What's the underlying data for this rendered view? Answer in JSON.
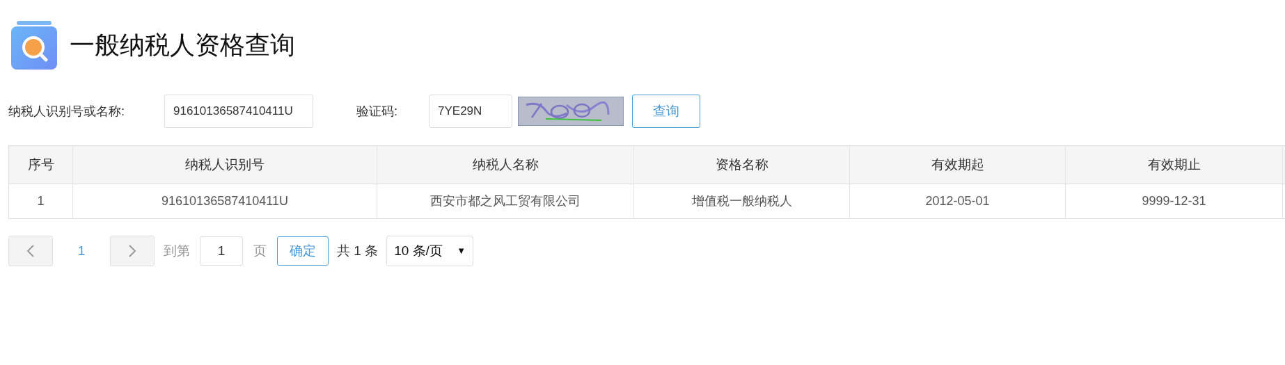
{
  "title": "一般纳税人资格查询",
  "form": {
    "taxpayer_label": "纳税人识别号或名称:",
    "taxpayer_value": "91610136587410411U",
    "captcha_label": "验证码:",
    "captcha_value": "7YE29N",
    "query_button": "查询"
  },
  "table": {
    "columns": [
      "序号",
      "纳税人识别号",
      "纳税人名称",
      "资格名称",
      "有效期起",
      "有效期止"
    ],
    "rows": [
      [
        "1",
        "91610136587410411U",
        "西安市都之风工贸有限公司",
        "增值税一般纳税人",
        "2012-05-01",
        "9999-12-31"
      ]
    ]
  },
  "pagination": {
    "pages": [
      {
        "label": "1",
        "selected": true
      }
    ],
    "goto_label": "到第",
    "goto_value": "1",
    "page_suffix": "页",
    "confirm_button": "确定",
    "total": "共 1 条",
    "page_size": "10 条/页",
    "page_size_caret": "▼"
  }
}
